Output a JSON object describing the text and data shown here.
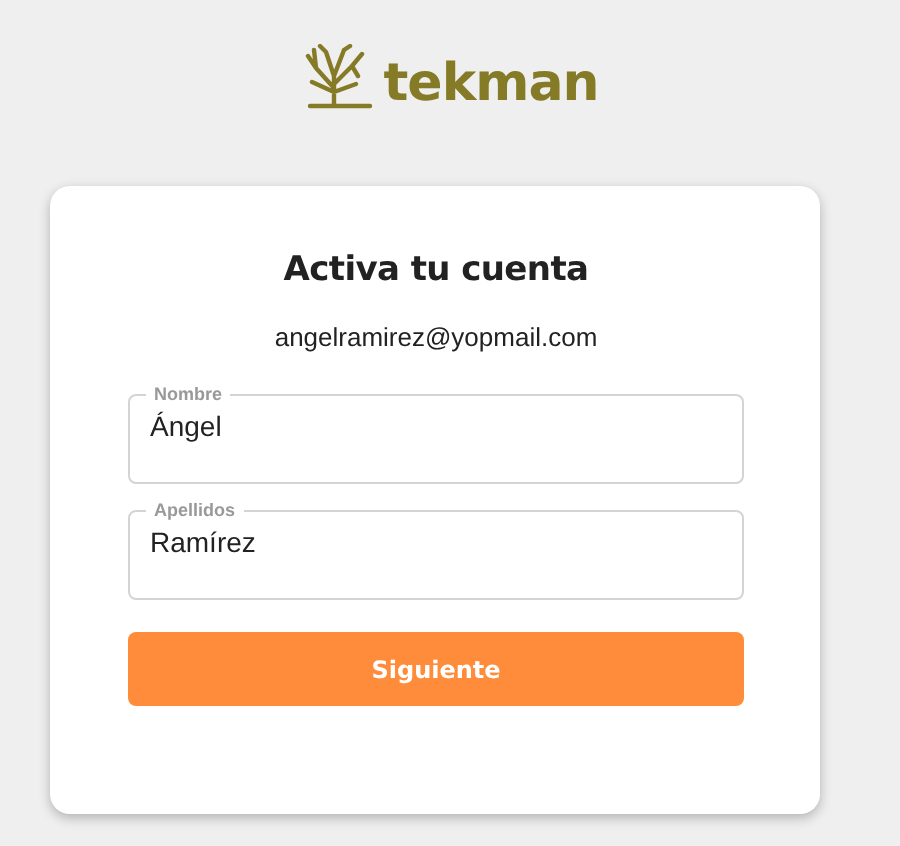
{
  "logo": {
    "text": "tekman"
  },
  "card": {
    "title": "Activa tu cuenta",
    "email": "angelramirez@yopmail.com",
    "fields": [
      {
        "label": "Nombre",
        "value": "Ángel"
      },
      {
        "label": "Apellidos",
        "value": "Ramírez"
      }
    ],
    "button": "Siguiente"
  }
}
